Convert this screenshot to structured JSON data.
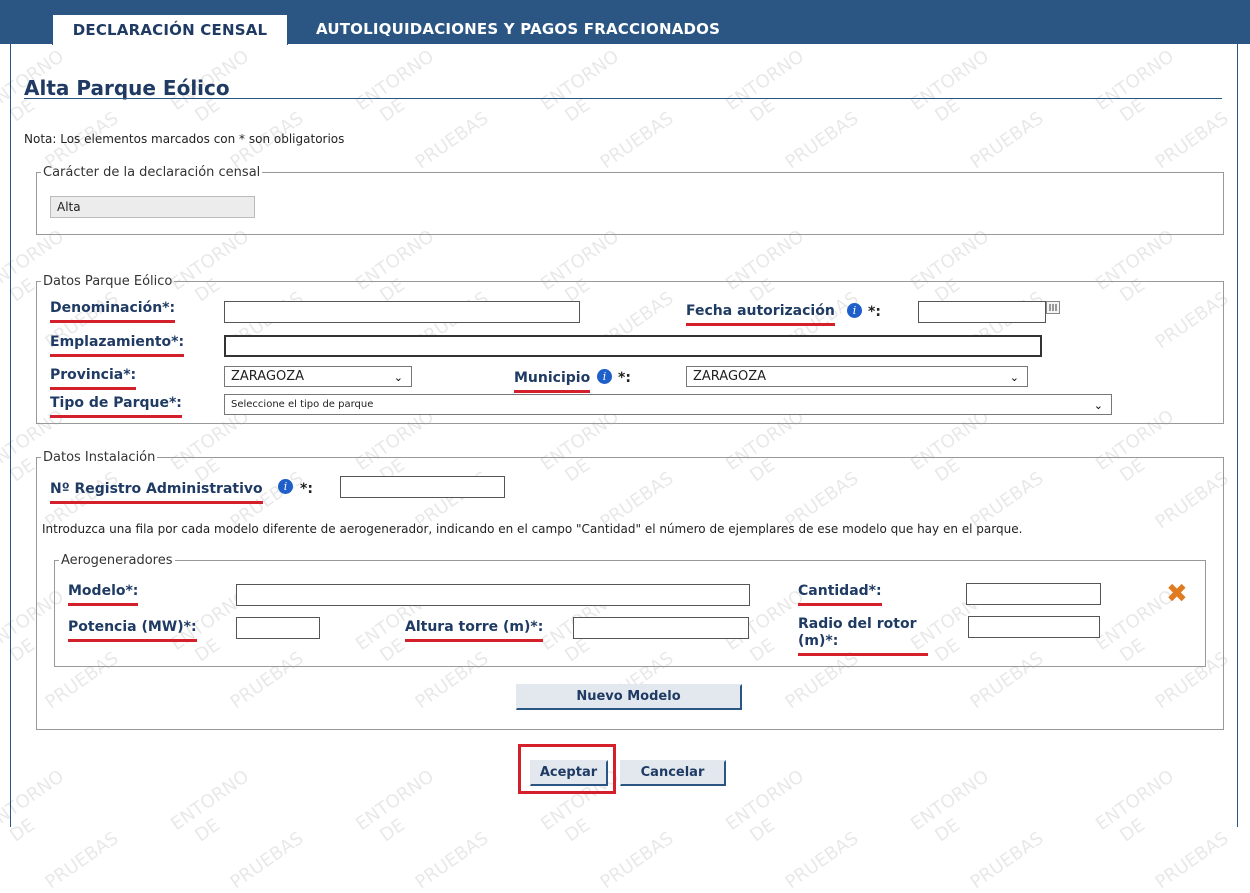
{
  "tabs": {
    "active": "DECLARACIÓN CENSAL",
    "other": "AUTOLIQUIDACIONES Y PAGOS FRACCIONADOS"
  },
  "page": {
    "title": "Alta Parque Eólico",
    "note": "Nota: Los elementos marcados con * son obligatorios"
  },
  "caracter": {
    "legend": "Carácter de la declaración censal",
    "value": "Alta"
  },
  "parque": {
    "legend": "Datos Parque Eólico",
    "denominacion_label": "Denominación*:",
    "fecha_label": "Fecha autorización",
    "fecha_suffix": "*:",
    "emplazamiento_label": "Emplazamiento*:",
    "provincia_label": "Provincia*:",
    "provincia_value": "ZARAGOZA",
    "municipio_label": "Municipio",
    "municipio_suffix": "*:",
    "municipio_value": "ZARAGOZA",
    "tipo_label": "Tipo de Parque*:",
    "tipo_value": "Seleccione el tipo de parque"
  },
  "instalacion": {
    "legend": "Datos Instalación",
    "registro_label": "Nº Registro Administrativo",
    "registro_suffix": "*:",
    "intro": "Introduzca una fila por cada modelo diferente de aerogenerador, indicando en el campo \"Cantidad\" el número de ejemplares de ese modelo que hay en el parque."
  },
  "aerogeneradores": {
    "legend": "Aerogeneradores",
    "modelo_label": "Modelo*:",
    "cantidad_label": "Cantidad*:",
    "potencia_label": "Potencia (MW)*:",
    "altura_label": "Altura torre (m)*:",
    "radio_label_1": "Radio del rotor",
    "radio_label_2": "(m)*:",
    "nuevo_modelo": "Nuevo Modelo"
  },
  "actions": {
    "aceptar": "Aceptar",
    "cancelar": "Cancelar"
  },
  "watermark": [
    "ENTORNO",
    "DE",
    "PRUEBAS"
  ],
  "colors": {
    "header": "#2b5684",
    "label": "#1f3b63",
    "underline": "#d4202a",
    "delete_icon": "#e07b22"
  }
}
